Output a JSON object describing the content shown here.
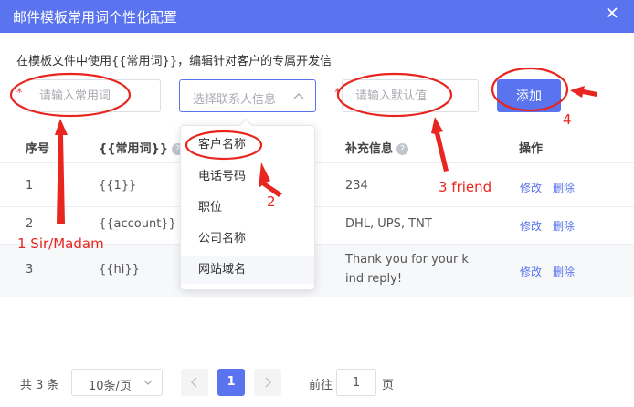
{
  "dialog": {
    "title": "邮件模板常用词个性化配置",
    "description": "在模板文件中使用{{常用词}}，编辑针对客户的专属开发信"
  },
  "form": {
    "required_mark": "*",
    "common_word_placeholder": "请输入常用词",
    "common_word_value": "",
    "contact_select_placeholder": "选择联系人信息",
    "default_value_placeholder": "请输入默认值",
    "default_value_value": "",
    "add_label": "添加"
  },
  "dropdown": {
    "options": [
      "客户名称",
      "电话号码",
      "职位",
      "公司名称",
      "网站域名"
    ]
  },
  "table": {
    "headers": {
      "index": "序号",
      "word": "{{常用词}}",
      "extra": "补充信息",
      "action": "操作"
    },
    "help_glyph": "?",
    "rows": [
      {
        "index": "1",
        "word": "{{1}}",
        "extra": "234",
        "edit": "修改",
        "delete": "删除"
      },
      {
        "index": "2",
        "word": "{{account}}",
        "extra": "DHL, UPS, TNT",
        "edit": "修改",
        "delete": "删除"
      },
      {
        "index": "3",
        "word": "{{hi}}",
        "extra": "Thank you for your kind reply!",
        "edit": "修改",
        "delete": "删除"
      }
    ]
  },
  "pagination": {
    "total": "共 3 条",
    "page_size": "10条/页",
    "current_page": "1",
    "goto_label": "前往",
    "goto_value": "1",
    "page_unit": "页"
  },
  "annotations": {
    "label_1": "1 Sir/Madam",
    "label_2": "2",
    "label_3": "3 friend",
    "label_4": "4",
    "color": "#e8251f"
  },
  "colors": {
    "primary": "#5a74ef",
    "required": "#e84a4a",
    "annotation": "#e8251f"
  },
  "icons": {
    "close": "close-icon",
    "chevron_up": "chevron-up-icon",
    "chevron_down": "chevron-down-icon",
    "help": "help-icon",
    "prev": "chevron-left-icon",
    "next": "chevron-right-icon"
  }
}
